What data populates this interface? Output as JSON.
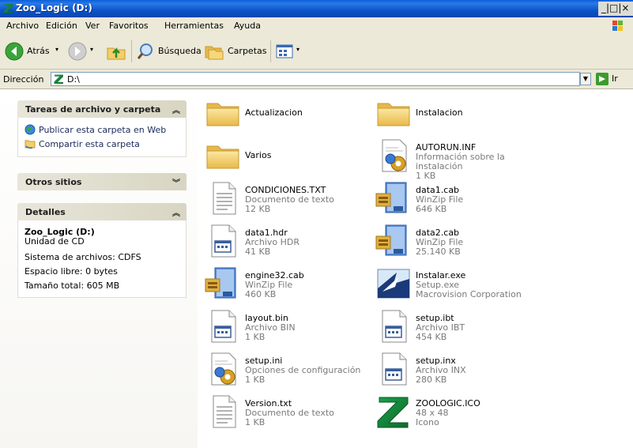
{
  "window": {
    "title": "Zoo_Logic (D:)",
    "controls": "_|□|×"
  },
  "menu": [
    "Archivo",
    "Edición",
    "Ver",
    "Favoritos",
    "Herramientas",
    "Ayuda"
  ],
  "toolbar": {
    "back": "Atrás",
    "search": "Búsqueda",
    "folders": "Carpetas"
  },
  "address": {
    "label": "Dirección",
    "value": "D:\\",
    "go": "Ir"
  },
  "taskpane": {
    "file_tasks": {
      "title": "Tareas de archivo y carpeta",
      "items": [
        "Publicar esta carpeta en Web",
        "Compartir esta carpeta"
      ]
    },
    "other_places": {
      "title": "Otros sitios"
    },
    "details": {
      "title": "Detalles",
      "name": "Zoo_Logic (D:)",
      "type": "Unidad de CD",
      "fs": "Sistema de archivos: CDFS",
      "free": "Espacio libre: 0 bytes",
      "total": "Tamaño total: 605 MB"
    }
  },
  "files": [
    {
      "name": "Actualizacion",
      "icon": "folder-icon"
    },
    {
      "name": "Instalacion",
      "icon": "folder-icon"
    },
    {
      "name": "Varios",
      "icon": "folder-icon"
    },
    {
      "name": "AUTORUN.INF",
      "l2": "Información sobre la instalación",
      "l3": "1 KB",
      "icon": "setup-info-icon"
    },
    {
      "name": "CONDICIONES.TXT",
      "l2": "Documento de texto",
      "l3": "12 KB",
      "icon": "text-document-icon"
    },
    {
      "name": "data1.cab",
      "l2": "WinZip File",
      "l3": "646 KB",
      "icon": "winzip-icon"
    },
    {
      "name": "data1.hdr",
      "l2": "Archivo HDR",
      "l3": "41 KB",
      "icon": "generic-file-icon"
    },
    {
      "name": "data2.cab",
      "l2": "WinZip File",
      "l3": "25.140 KB",
      "icon": "winzip-icon"
    },
    {
      "name": "engine32.cab",
      "l2": "WinZip File",
      "l3": "460 KB",
      "icon": "winzip-icon"
    },
    {
      "name": "Instalar.exe",
      "l2": "Setup.exe",
      "l3": "Macrovision Corporation",
      "icon": "installer-icon"
    },
    {
      "name": "layout.bin",
      "l2": "Archivo BIN",
      "l3": "1 KB",
      "icon": "generic-file-icon"
    },
    {
      "name": "setup.ibt",
      "l2": "Archivo IBT",
      "l3": "454 KB",
      "icon": "generic-file-icon"
    },
    {
      "name": "setup.ini",
      "l2": "Opciones de configuración",
      "l3": "1 KB",
      "icon": "setup-info-icon"
    },
    {
      "name": "setup.inx",
      "l2": "Archivo INX",
      "l3": "280 KB",
      "icon": "generic-file-icon"
    },
    {
      "name": "Version.txt",
      "l2": "Documento de texto",
      "l3": "1 KB",
      "icon": "text-document-icon"
    },
    {
      "name": "ZOOLOGIC.ICO",
      "l2": "48 x 48",
      "l3": "Icono",
      "icon": "zoologic-z-icon"
    }
  ],
  "colors": {
    "titlebar": "#0a5fd8",
    "link": "#1a2a5a",
    "folder": "#f2cf6a"
  }
}
